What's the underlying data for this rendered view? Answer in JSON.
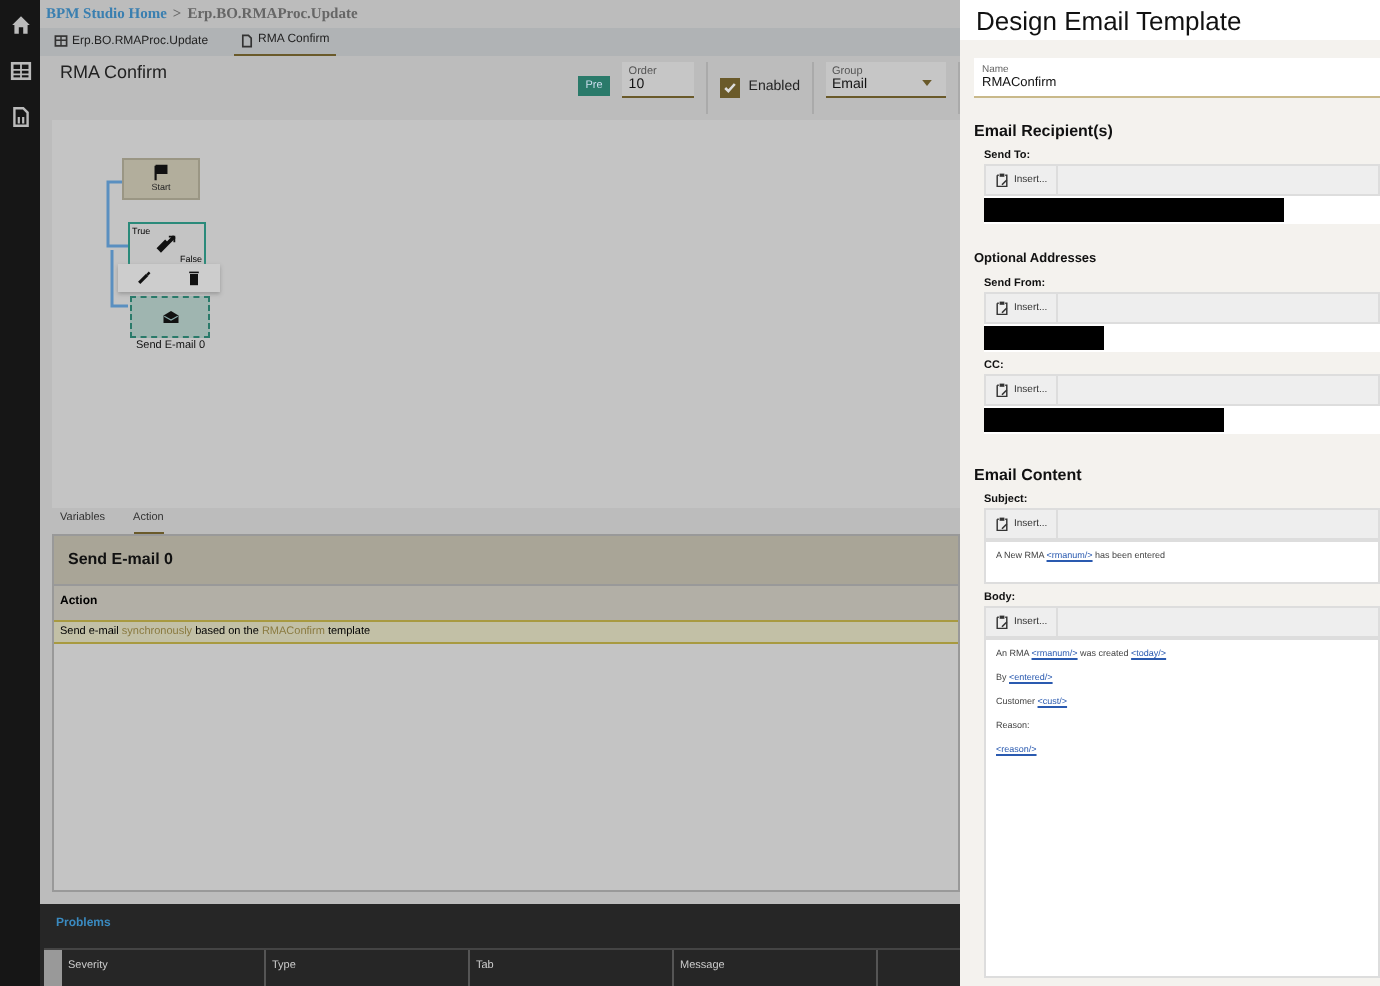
{
  "breadcrumb": {
    "home": "BPM Studio Home",
    "separator": ">",
    "current": "Erp.BO.RMAProc.Update"
  },
  "tabs": [
    {
      "label": "Erp.BO.RMAProc.Update",
      "selected": false,
      "kind": "grid"
    },
    {
      "label": "RMA Confirm",
      "selected": true,
      "kind": "doc"
    }
  ],
  "header": {
    "title": "RMA Confirm",
    "badge": "Pre",
    "order": {
      "label": "Order",
      "value": "10"
    },
    "enabled": {
      "label": "Enabled",
      "checked": true
    },
    "group": {
      "label": "Group",
      "value": "Email"
    }
  },
  "diagram": {
    "start": {
      "label": "Start"
    },
    "condition": {
      "true_label": "True",
      "false_label": "False"
    },
    "email": {
      "label": "Send E-mail 0"
    }
  },
  "bottom_tabs": [
    {
      "label": "Variables",
      "selected": false
    },
    {
      "label": "Action",
      "selected": true
    }
  ],
  "action_panel": {
    "title": "Send E-mail 0",
    "column": "Action",
    "rows": [
      {
        "selected": true,
        "parts": [
          {
            "kind": "text",
            "text": "Send e-mail "
          },
          {
            "kind": "link",
            "text": "synchronously"
          },
          {
            "kind": "text",
            "text": " based on the "
          },
          {
            "kind": "link",
            "text": "RMAConfirm"
          },
          {
            "kind": "text",
            "text": " template"
          }
        ]
      }
    ]
  },
  "problems": {
    "title": "Problems",
    "columns": [
      "Severity",
      "Type",
      "Tab",
      "Message"
    ]
  },
  "dialog": {
    "title": "Design Email Template",
    "name": {
      "label": "Name",
      "value": "RMAConfirm"
    },
    "sections": [
      {
        "kind": "heading",
        "text": "Email Recipient(s)"
      },
      {
        "kind": "address_field",
        "label": "Send To:",
        "insert": "Insert..."
      },
      {
        "kind": "subheading",
        "text": "Optional Addresses"
      },
      {
        "kind": "address_field",
        "label": "Send From:",
        "insert": "Insert..."
      },
      {
        "kind": "address_field",
        "label": "CC:",
        "insert": "Insert..."
      },
      {
        "kind": "heading",
        "text": "Email Content"
      },
      {
        "kind": "text_field",
        "label": "Subject:",
        "insert": "Insert...",
        "lines": [
          [
            {
              "kind": "text",
              "text": "A New RMA "
            },
            {
              "kind": "link",
              "text": "<rmanum/>"
            },
            {
              "kind": "text",
              "text": " has been entered"
            }
          ]
        ]
      },
      {
        "kind": "body_field",
        "label": "Body:",
        "insert": "Insert...",
        "lines": [
          [
            {
              "kind": "text",
              "text": "An RMA "
            },
            {
              "kind": "link",
              "text": "<rmanum/>"
            },
            {
              "kind": "text",
              "text": " was created "
            },
            {
              "kind": "link",
              "text": "<today/>"
            }
          ],
          [
            {
              "kind": "text",
              "text": "By "
            },
            {
              "kind": "link",
              "text": "<entered/>"
            }
          ],
          [
            {
              "kind": "text",
              "text": "Customer "
            },
            {
              "kind": "link",
              "text": "<cust/>"
            }
          ],
          [
            {
              "kind": "text",
              "text": "Reason:"
            }
          ],
          [
            {
              "kind": "link",
              "text": "<reason/>"
            }
          ]
        ]
      }
    ]
  }
}
